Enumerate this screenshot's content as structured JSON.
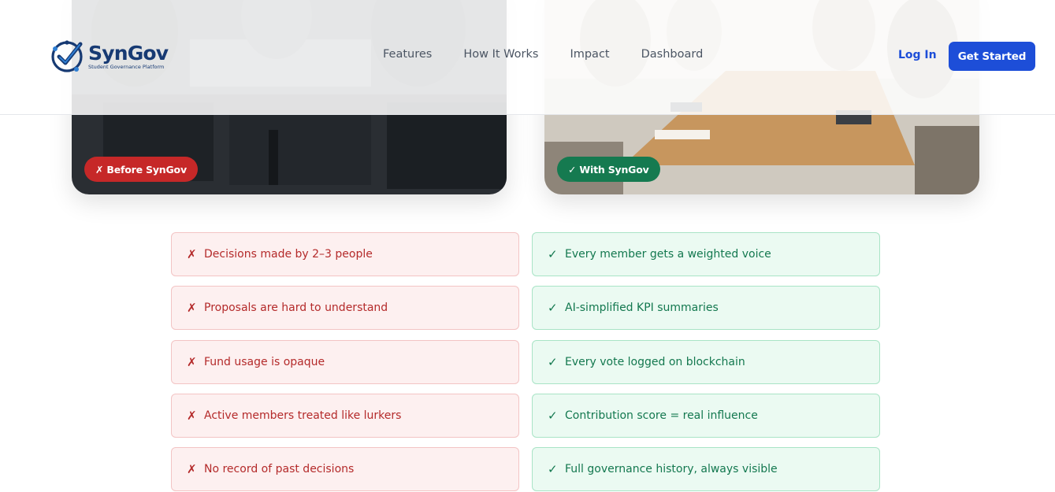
{
  "header": {
    "logo": {
      "name": "SynGov",
      "tagline": "Student Governance Platform"
    },
    "nav": [
      "Features",
      "How It Works",
      "Impact",
      "Dashboard"
    ],
    "login": "Log In",
    "cta": "Get Started"
  },
  "photos": {
    "before_badge": "✗ Before SynGov",
    "after_badge": "✓ With SynGov"
  },
  "colors": {
    "brand": "#173a73",
    "cta": "#1d4ed8",
    "before": "#c62828",
    "after": "#157a50"
  },
  "comparison": {
    "before_mark": "✗",
    "after_mark": "✓",
    "before": [
      "Decisions made by 2–3 people",
      "Proposals are hard to understand",
      "Fund usage is opaque",
      "Active members treated like lurkers",
      "No record of past decisions"
    ],
    "after": [
      "Every member gets a weighted voice",
      "AI-simplified KPI summaries",
      "Every vote logged on blockchain",
      "Contribution score = real influence",
      "Full governance history, always visible"
    ]
  }
}
